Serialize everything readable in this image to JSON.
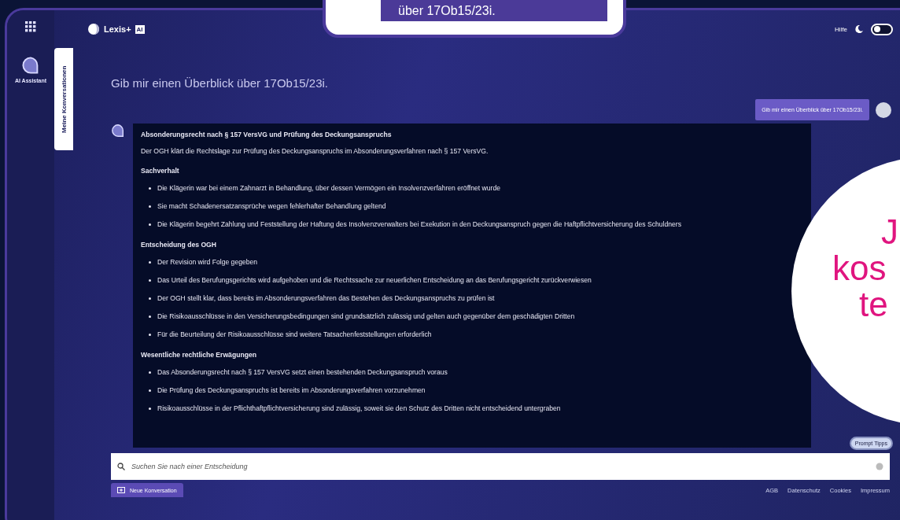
{
  "callout": {
    "text": "über 17Ob15/23i."
  },
  "brand": {
    "name": "Lexis+",
    "badge": "AI"
  },
  "rail": {
    "items": [
      {
        "label": "AI Assistant",
        "selected": true
      }
    ]
  },
  "side_tab": {
    "label": "Meine Konversationen"
  },
  "topbar": {
    "help": "Hilfe",
    "dark_mode": {
      "on": false
    }
  },
  "chat_title": "Gib mir einen Überblick über 17Ob15/23i.",
  "user_message": "Gib mir einen Überblick über 17Ob15/23i.",
  "answer": {
    "title": "Absonderungsrecht nach § 157 VersVG und Prüfung des Deckungsanspruchs",
    "intro": "Der OGH klärt die Rechtslage zur Prüfung des Deckungsanspruchs im Absonderungsverfahren nach § 157 VersVG.",
    "sections": [
      {
        "heading": "Sachverhalt",
        "bullets": [
          "Die Klägerin war bei einem Zahnarzt in Behandlung, über dessen Vermögen ein Insolvenzverfahren eröffnet wurde",
          "Sie macht Schadenersatzansprüche wegen fehlerhafter Behandlung geltend",
          "Die Klägerin begehrt Zahlung und Feststellung der Haftung des Insolvenzverwalters bei Exekution in den Deckungsanspruch gegen die Haftpflichtversicherung des Schuldners"
        ]
      },
      {
        "heading": "Entscheidung des OGH",
        "bullets": [
          "Der Revision wird Folge gegeben",
          "Das Urteil des Berufungsgerichts wird aufgehoben und die Rechtssache zur neuerlichen Entscheidung an das Berufungsgericht zurückverwiesen",
          "Der OGH stellt klar, dass bereits im Absonderungsverfahren das Bestehen des Deckungsanspruchs zu prüfen ist",
          "Die Risikoausschlüsse in den Versicherungsbedingungen sind grundsätzlich zulässig und gelten auch gegenüber dem geschädigten Dritten",
          "Für die Beurteilung der Risikoausschlüsse sind weitere Tatsachenfeststellungen erforderlich"
        ]
      },
      {
        "heading": "Wesentliche rechtliche Erwägungen",
        "bullets": [
          "Das Absonderungsrecht nach § 157 VersVG setzt einen bestehenden Deckungsanspruch voraus",
          "Die Prüfung des Deckungsanspruchs ist bereits im Absonderungsverfahren vorzunehmen",
          "Risikoausschlüsse in der Pflichthaftpflichtversicherung sind zulässig, soweit sie den Schutz des Dritten nicht entscheidend untergraben"
        ]
      }
    ]
  },
  "prompt_tips": "Prompt Tipps",
  "search": {
    "placeholder": "Suchen Sie nach einer Entscheidung"
  },
  "new_conversation": "Neue Konversation",
  "footer_links": [
    "AGB",
    "Datenschutz",
    "Cookies",
    "Impressum"
  ],
  "circle": {
    "lines": [
      "J",
      "kos",
      "te"
    ]
  }
}
